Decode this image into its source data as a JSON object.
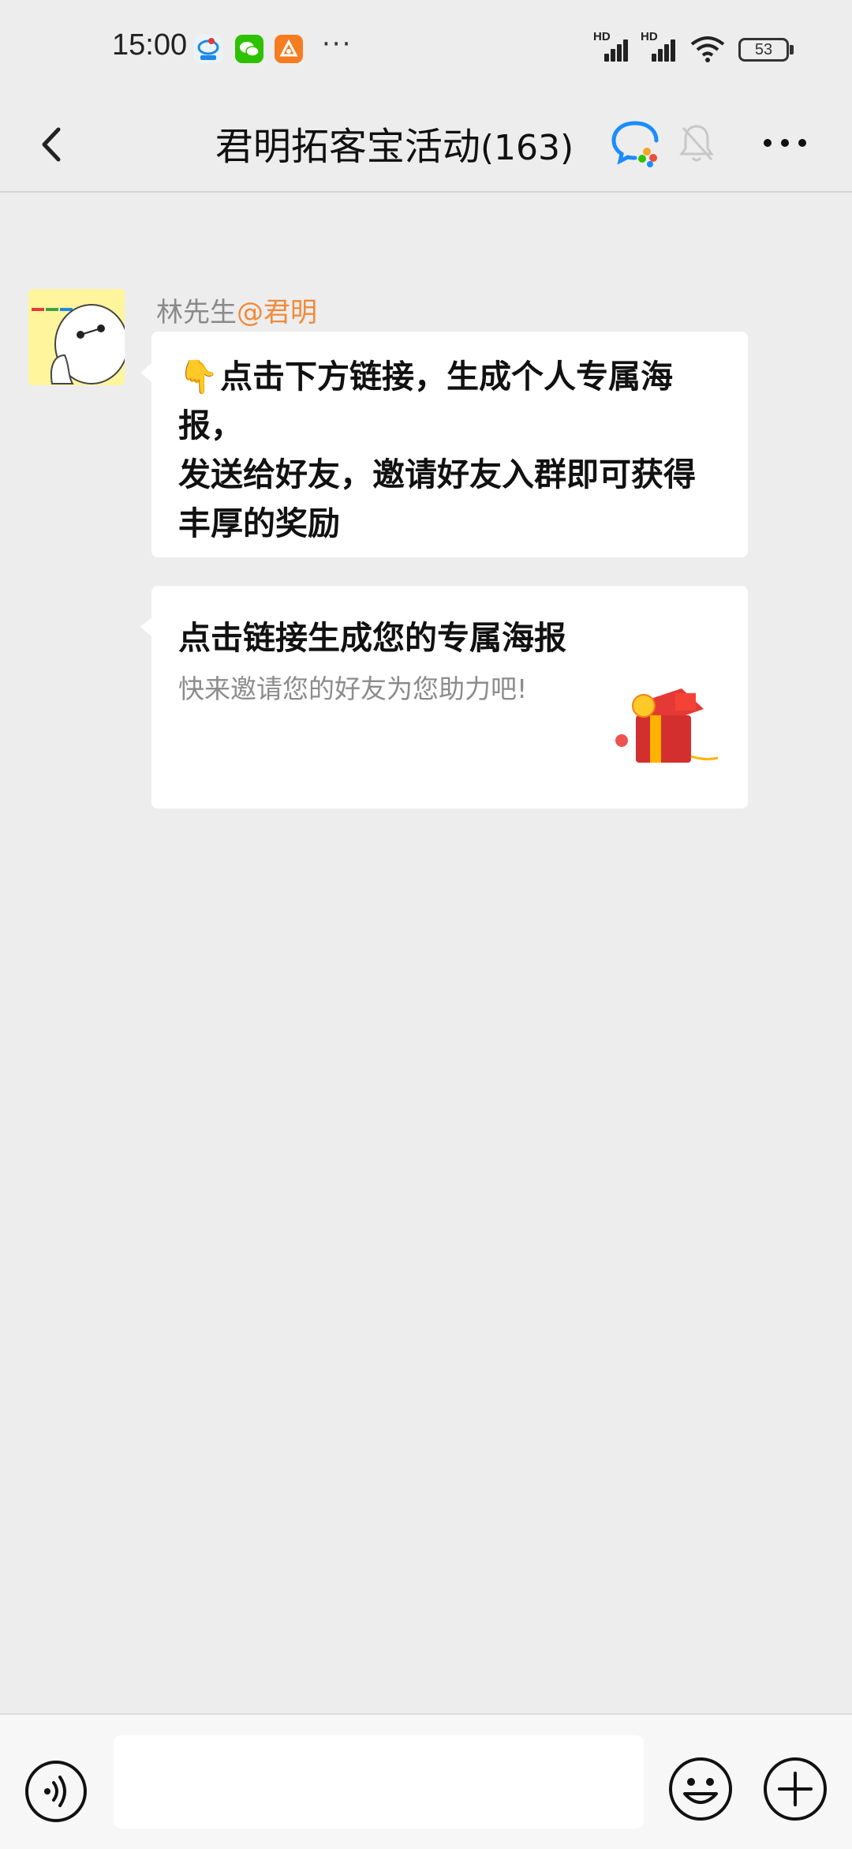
{
  "status_bar": {
    "time": "15:00",
    "more": "···",
    "signal_1_label": "HD",
    "signal_2_label": "HD",
    "battery": "53"
  },
  "header": {
    "title": "君明拓客宝活动",
    "member_count": "(163)"
  },
  "messages": [
    {
      "sender_name": "林先生",
      "sender_tag": "@君明",
      "text_line_1": "点击下方链接，生成个人专属海报，",
      "text_line_2": "发送给好友，邀请好友入群即可获得丰厚的奖励"
    },
    {
      "link_title": "点击链接生成您的专属海报",
      "link_description": "快来邀请您的好友为您助力吧!"
    }
  ],
  "icons": {
    "back": "chevron-left-icon",
    "chat": "chat-bubble-icon",
    "mute": "bell-mute-icon",
    "more": "more-dots-icon",
    "voice": "voice-icon",
    "emoji": "emoji-icon",
    "plus": "plus-icon",
    "hand": "pointing-down-hand-icon",
    "gift": "red-gift-box-icon"
  },
  "colors": {
    "background": "#ededed",
    "accent_tag": "#f08a3a",
    "chat_icon_blue": "#1a8cff"
  }
}
